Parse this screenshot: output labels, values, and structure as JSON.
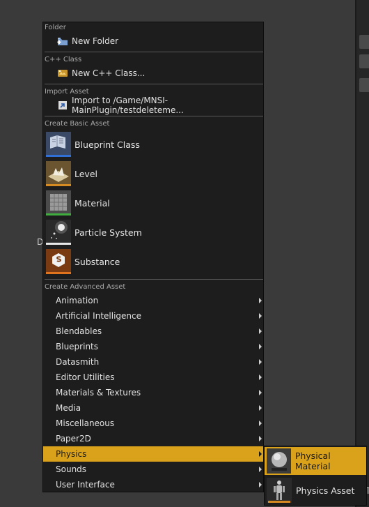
{
  "background": {
    "partial_label_left": "D",
    "partial_label_right": "T"
  },
  "menu": {
    "sections": {
      "folder": "Folder",
      "cpp": "C++ Class",
      "import": "Import Asset",
      "basic": "Create Basic Asset",
      "advanced": "Create Advanced Asset"
    },
    "new_folder": "New Folder",
    "new_cpp_class": "New C++ Class...",
    "import_to": "Import to /Game/MNSI-MainPlugin/testdeleteme...",
    "basic_assets": [
      {
        "label": "Blueprint Class",
        "stripe": "#2f6fd6"
      },
      {
        "label": "Level",
        "stripe": "#d68a22"
      },
      {
        "label": "Material",
        "stripe": "#3fae3f"
      },
      {
        "label": "Particle System",
        "stripe": "#e8e8e8"
      },
      {
        "label": "Substance",
        "stripe": "#e0731e"
      }
    ],
    "advanced_assets": [
      {
        "label": "Animation",
        "selected": false
      },
      {
        "label": "Artificial Intelligence",
        "selected": false
      },
      {
        "label": "Blendables",
        "selected": false
      },
      {
        "label": "Blueprints",
        "selected": false
      },
      {
        "label": "Datasmith",
        "selected": false
      },
      {
        "label": "Editor Utilities",
        "selected": false
      },
      {
        "label": "Materials & Textures",
        "selected": false
      },
      {
        "label": "Media",
        "selected": false
      },
      {
        "label": "Miscellaneous",
        "selected": false
      },
      {
        "label": "Paper2D",
        "selected": false
      },
      {
        "label": "Physics",
        "selected": true
      },
      {
        "label": "Sounds",
        "selected": false
      },
      {
        "label": "User Interface",
        "selected": false
      }
    ]
  },
  "submenu": {
    "items": [
      {
        "label": "Physical Material",
        "selected": true
      },
      {
        "label": "Physics Asset",
        "selected": false
      }
    ]
  },
  "colors": {
    "highlight": "#d9a21a",
    "menu_bg": "#1d1d1d"
  }
}
